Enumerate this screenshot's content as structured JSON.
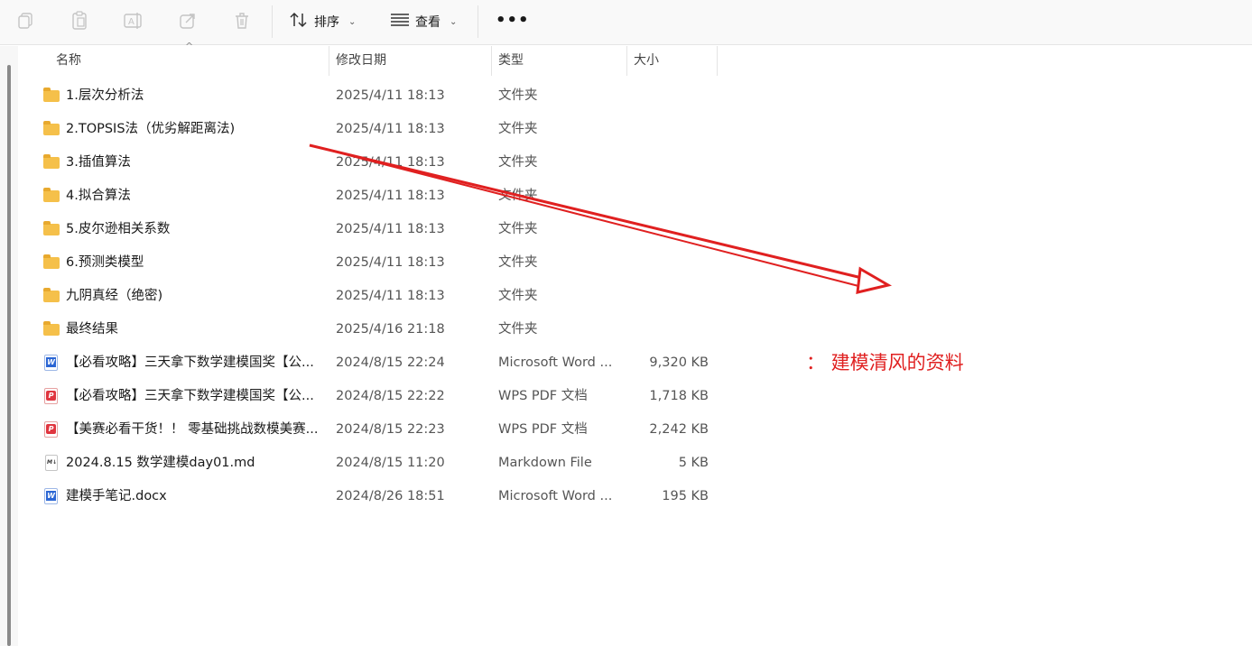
{
  "toolbar": {
    "icons": [
      "copy-icon",
      "paste-icon",
      "rename-icon",
      "share-icon",
      "delete-icon"
    ],
    "sort_label": "排序",
    "view_label": "查看",
    "more_label": "•••"
  },
  "columns": {
    "name": "名称",
    "date": "修改日期",
    "type": "类型",
    "size": "大小"
  },
  "files": [
    {
      "icon": "folder-icon",
      "name": "1.层次分析法",
      "date": "2025/4/11 18:13",
      "type": "文件夹",
      "size": ""
    },
    {
      "icon": "folder-icon",
      "name": "2.TOPSIS法（优劣解距离法)",
      "date": "2025/4/11 18:13",
      "type": "文件夹",
      "size": ""
    },
    {
      "icon": "folder-icon",
      "name": "3.插值算法",
      "date": "2025/4/11 18:13",
      "type": "文件夹",
      "size": ""
    },
    {
      "icon": "folder-icon",
      "name": "4.拟合算法",
      "date": "2025/4/11 18:13",
      "type": "文件夹",
      "size": ""
    },
    {
      "icon": "folder-icon",
      "name": "5.皮尔逊相关系数",
      "date": "2025/4/11 18:13",
      "type": "文件夹",
      "size": ""
    },
    {
      "icon": "folder-icon",
      "name": "6.预测类模型",
      "date": "2025/4/11 18:13",
      "type": "文件夹",
      "size": ""
    },
    {
      "icon": "folder-icon",
      "name": "九阴真经（绝密)",
      "date": "2025/4/11 18:13",
      "type": "文件夹",
      "size": ""
    },
    {
      "icon": "folder-icon",
      "name": "最终结果",
      "date": "2025/4/16 21:18",
      "type": "文件夹",
      "size": ""
    },
    {
      "icon": "word-icon",
      "name": "【必看攻略】三天拿下数学建模国奖【公...",
      "date": "2024/8/15 22:24",
      "type": "Microsoft Word ...",
      "size": "9,320 KB"
    },
    {
      "icon": "pdf-icon",
      "name": "【必看攻略】三天拿下数学建模国奖【公...",
      "date": "2024/8/15 22:22",
      "type": "WPS PDF 文档",
      "size": "1,718 KB"
    },
    {
      "icon": "pdf-icon",
      "name": "【美赛必看干货！！ 零基础挑战数模美赛...",
      "date": "2024/8/15 22:23",
      "type": "WPS PDF 文档",
      "size": "2,242 KB"
    },
    {
      "icon": "markdown-icon",
      "name": "2024.8.15  数学建模day01.md",
      "date": "2024/8/15 11:20",
      "type": "Markdown File",
      "size": "5 KB"
    },
    {
      "icon": "word-icon",
      "name": "建模手笔记.docx",
      "date": "2024/8/26 18:51",
      "type": "Microsoft Word ...",
      "size": "195 KB"
    }
  ],
  "annotation": {
    "text": "： 建模清风的资料",
    "color": "#e02020"
  }
}
